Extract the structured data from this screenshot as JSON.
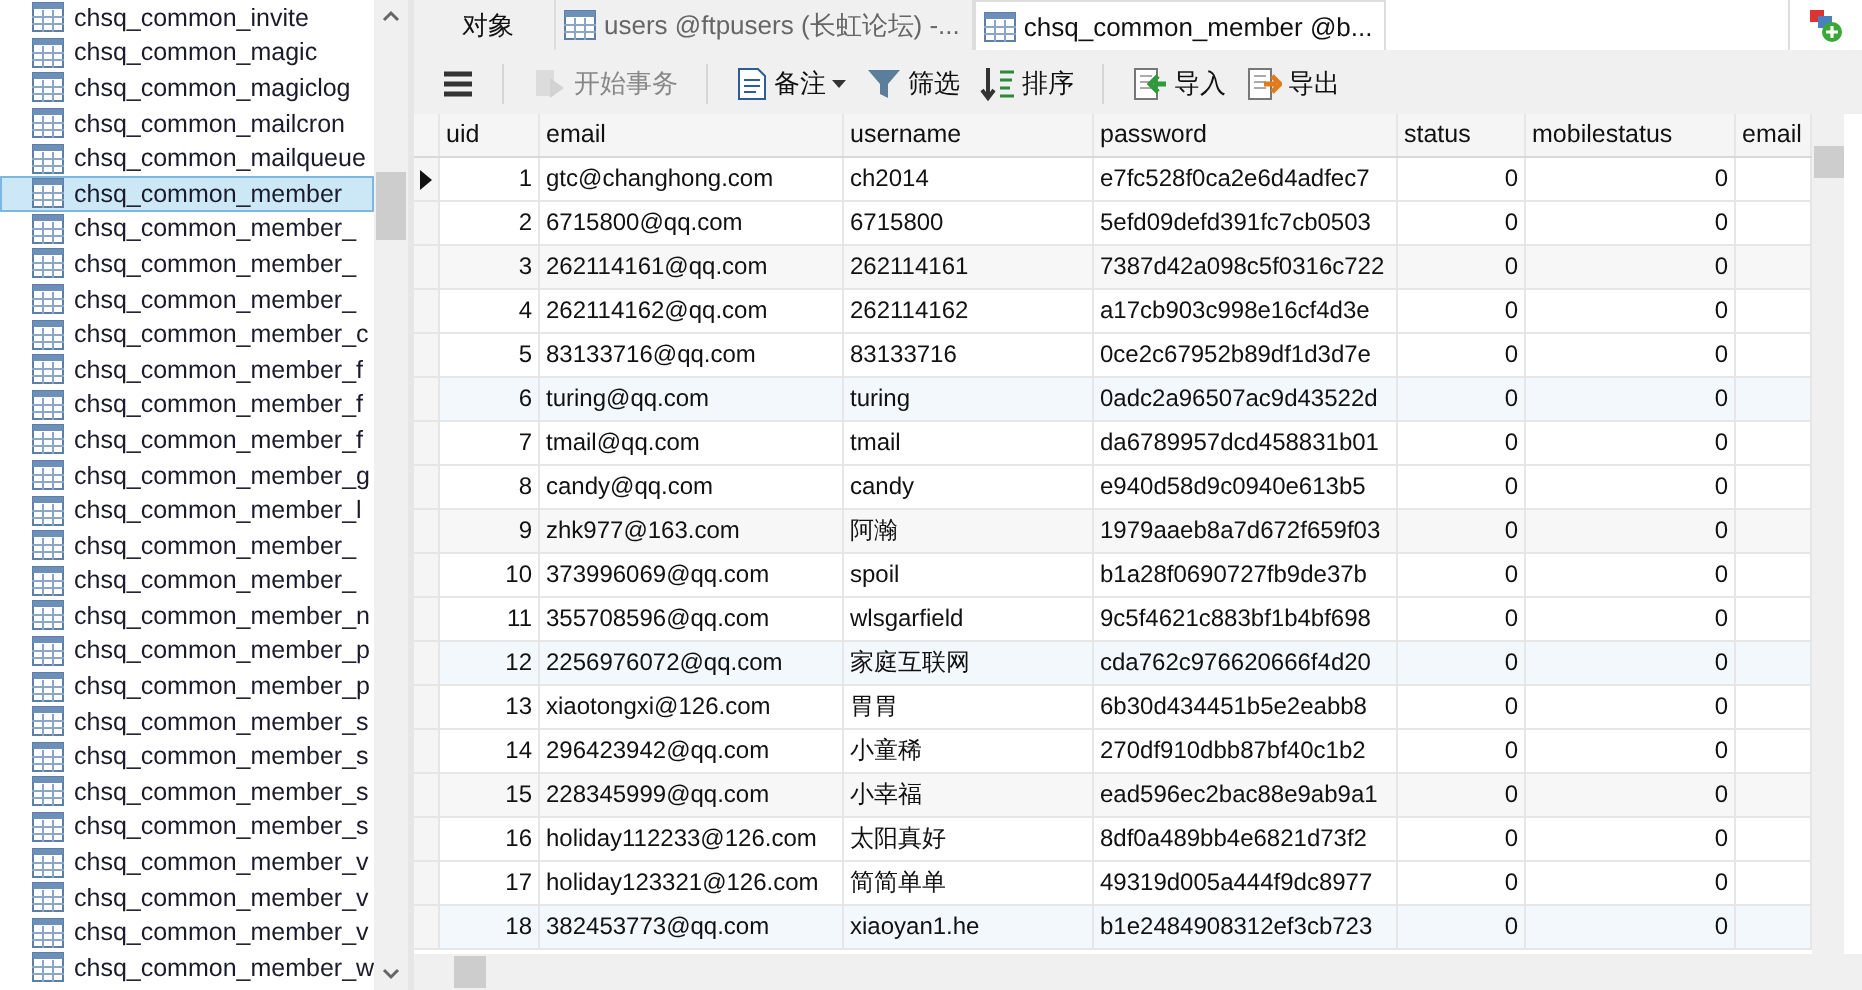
{
  "sidebar": {
    "items": [
      {
        "label": "chsq_common_invite",
        "selected": false
      },
      {
        "label": "chsq_common_magic",
        "selected": false
      },
      {
        "label": "chsq_common_magiclog",
        "selected": false
      },
      {
        "label": "chsq_common_mailcron",
        "selected": false
      },
      {
        "label": "chsq_common_mailqueue",
        "selected": false
      },
      {
        "label": "chsq_common_member",
        "selected": true
      },
      {
        "label": "chsq_common_member_",
        "selected": false
      },
      {
        "label": "chsq_common_member_",
        "selected": false
      },
      {
        "label": "chsq_common_member_",
        "selected": false
      },
      {
        "label": "chsq_common_member_c",
        "selected": false
      },
      {
        "label": "chsq_common_member_f",
        "selected": false
      },
      {
        "label": "chsq_common_member_f",
        "selected": false
      },
      {
        "label": "chsq_common_member_f",
        "selected": false
      },
      {
        "label": "chsq_common_member_g",
        "selected": false
      },
      {
        "label": "chsq_common_member_l",
        "selected": false
      },
      {
        "label": "chsq_common_member_",
        "selected": false
      },
      {
        "label": "chsq_common_member_",
        "selected": false
      },
      {
        "label": "chsq_common_member_n",
        "selected": false
      },
      {
        "label": "chsq_common_member_p",
        "selected": false
      },
      {
        "label": "chsq_common_member_p",
        "selected": false
      },
      {
        "label": "chsq_common_member_s",
        "selected": false
      },
      {
        "label": "chsq_common_member_s",
        "selected": false
      },
      {
        "label": "chsq_common_member_s",
        "selected": false
      },
      {
        "label": "chsq_common_member_s",
        "selected": false
      },
      {
        "label": "chsq_common_member_v",
        "selected": false
      },
      {
        "label": "chsq_common_member_v",
        "selected": false
      },
      {
        "label": "chsq_common_member_v",
        "selected": false
      },
      {
        "label": "chsq_common_member_w",
        "selected": false
      }
    ]
  },
  "tabs": [
    {
      "label": "对象",
      "kind": "objects",
      "selected": false
    },
    {
      "label": "users @ftpusers (长虹论坛) -...",
      "kind": "table",
      "selected": false
    },
    {
      "label": "chsq_common_member @b...",
      "kind": "table",
      "selected": true
    }
  ],
  "toolbar": [
    {
      "kind": "menu",
      "disabled": false,
      "dropdown": false
    },
    {
      "kind": "separator"
    },
    {
      "kind": "begin",
      "label": "开始事务",
      "disabled": true,
      "dropdown": false
    },
    {
      "kind": "separator"
    },
    {
      "kind": "comment",
      "label": "备注",
      "disabled": false,
      "dropdown": true
    },
    {
      "kind": "filter",
      "label": "筛选",
      "disabled": false,
      "dropdown": false
    },
    {
      "kind": "sort",
      "label": "排序",
      "disabled": false,
      "dropdown": false
    },
    {
      "kind": "separator"
    },
    {
      "kind": "import",
      "label": "导入",
      "disabled": false,
      "dropdown": false
    },
    {
      "kind": "export",
      "label": "导出",
      "disabled": false,
      "dropdown": false
    }
  ],
  "table": {
    "columns": [
      "uid",
      "email",
      "username",
      "password",
      "status",
      "mobilestatus",
      "email"
    ],
    "rows": [
      {
        "current": true,
        "cells": [
          "1",
          "gtc@changhong.com",
          "ch2014",
          "e7fc528f0ca2e6d4adfec7",
          "0",
          "0"
        ]
      },
      {
        "current": false,
        "cells": [
          "2",
          "6715800@qq.com",
          "6715800",
          "5efd09defd391fc7cb0503",
          "0",
          "0"
        ]
      },
      {
        "current": false,
        "cells": [
          "3",
          "262114161@qq.com",
          "262114161",
          "7387d42a098c5f0316c722",
          "0",
          "0"
        ]
      },
      {
        "current": false,
        "cells": [
          "4",
          "262114162@qq.com",
          "262114162",
          "a17cb903c998e16cf4d3e",
          "0",
          "0"
        ]
      },
      {
        "current": false,
        "cells": [
          "5",
          "83133716@qq.com",
          "83133716",
          "0ce2c67952b89df1d3d7e",
          "0",
          "0"
        ]
      },
      {
        "current": false,
        "cells": [
          "6",
          "turing@qq.com",
          "turing",
          "0adc2a96507ac9d43522d",
          "0",
          "0"
        ]
      },
      {
        "current": false,
        "cells": [
          "7",
          "tmail@qq.com",
          "tmail",
          "da6789957dcd458831b01",
          "0",
          "0"
        ]
      },
      {
        "current": false,
        "cells": [
          "8",
          "candy@qq.com",
          "candy",
          "e940d58d9c0940e613b5",
          "0",
          "0"
        ]
      },
      {
        "current": false,
        "cells": [
          "9",
          "zhk977@163.com",
          "阿瀚",
          "1979aaeb8a7d672f659f03",
          "0",
          "0"
        ]
      },
      {
        "current": false,
        "cells": [
          "10",
          "373996069@qq.com",
          "spoil",
          "b1a28f0690727fb9de37b",
          "0",
          "0"
        ]
      },
      {
        "current": false,
        "cells": [
          "11",
          "355708596@qq.com",
          "wlsgarfield",
          "9c5f4621c883bf1b4bf698",
          "0",
          "0"
        ]
      },
      {
        "current": false,
        "cells": [
          "12",
          "2256976072@qq.com",
          "家庭互联网",
          "cda762c976620666f4d20",
          "0",
          "0"
        ]
      },
      {
        "current": false,
        "cells": [
          "13",
          "xiaotongxi@126.com",
          "胃胃",
          "6b30d434451b5e2eabb8",
          "0",
          "0"
        ]
      },
      {
        "current": false,
        "cells": [
          "14",
          "296423942@qq.com",
          "小童稀",
          "270df910dbb87bf40c1b2",
          "0",
          "0"
        ]
      },
      {
        "current": false,
        "cells": [
          "15",
          "228345999@qq.com",
          "小幸福",
          "ead596ec2bac88e9ab9a1",
          "0",
          "0"
        ]
      },
      {
        "current": false,
        "cells": [
          "16",
          "holiday112233@126.com",
          "太阳真好",
          "8df0a489bb4e6821d73f2",
          "0",
          "0"
        ]
      },
      {
        "current": false,
        "cells": [
          "17",
          "holiday123321@126.com",
          "简简单单",
          "49319d005a444f9dc8977",
          "0",
          "0"
        ]
      },
      {
        "current": false,
        "cells": [
          "18",
          "382453773@qq.com",
          "xiaoyan1.he",
          "b1e2484908312ef3cb723",
          "0",
          "0"
        ]
      }
    ]
  }
}
